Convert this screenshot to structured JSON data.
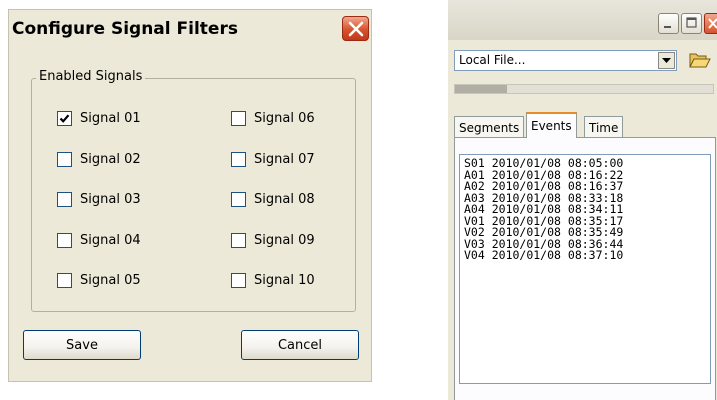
{
  "dialog": {
    "title": "Configure Signal Filters",
    "group_label": "Enabled Signals",
    "signals_left": [
      {
        "label": "Signal 01",
        "checked": true
      },
      {
        "label": "Signal 02",
        "checked": false
      },
      {
        "label": "Signal 03",
        "checked": false
      },
      {
        "label": "Signal 04",
        "checked": false
      },
      {
        "label": "Signal 05",
        "checked": false
      }
    ],
    "signals_right": [
      {
        "label": "Signal 06",
        "checked": false
      },
      {
        "label": "Signal 07",
        "checked": false
      },
      {
        "label": "Signal 08",
        "checked": false
      },
      {
        "label": "Signal 09",
        "checked": false
      },
      {
        "label": "Signal 10",
        "checked": false
      }
    ],
    "save_label": "Save",
    "cancel_label": "Cancel"
  },
  "window": {
    "source_select": "Local File...",
    "progress_fraction": 0.2,
    "tabs": [
      {
        "label": "Segments",
        "active": false
      },
      {
        "label": "Events",
        "active": true
      },
      {
        "label": "Time",
        "active": false
      }
    ],
    "events": [
      {
        "code": "S01",
        "date": "2010/01/08",
        "time": "08:05:00"
      },
      {
        "code": "A01",
        "date": "2010/01/08",
        "time": "08:16:22"
      },
      {
        "code": "A02",
        "date": "2010/01/08",
        "time": "08:16:37"
      },
      {
        "code": "A03",
        "date": "2010/01/08",
        "time": "08:33:18"
      },
      {
        "code": "A04",
        "date": "2010/01/08",
        "time": "08:34:11"
      },
      {
        "code": "V01",
        "date": "2010/01/08",
        "time": "08:35:17"
      },
      {
        "code": "V02",
        "date": "2010/01/08",
        "time": "08:35:49"
      },
      {
        "code": "V03",
        "date": "2010/01/08",
        "time": "08:36:44"
      },
      {
        "code": "V04",
        "date": "2010/01/08",
        "time": "08:37:10"
      }
    ]
  },
  "icons": {
    "close": "close-icon",
    "minimize": "minimize-icon",
    "maximize": "maximize-icon",
    "dropdown": "chevron-down-icon",
    "open_folder": "open-folder-icon",
    "checkmark": "checkmark-icon"
  },
  "colors": {
    "dialog_bg": "#ece9d8",
    "close_red": "#d6532d",
    "active_tab_accent": "#e68b2c",
    "checkbox_border": "#1c5180"
  }
}
